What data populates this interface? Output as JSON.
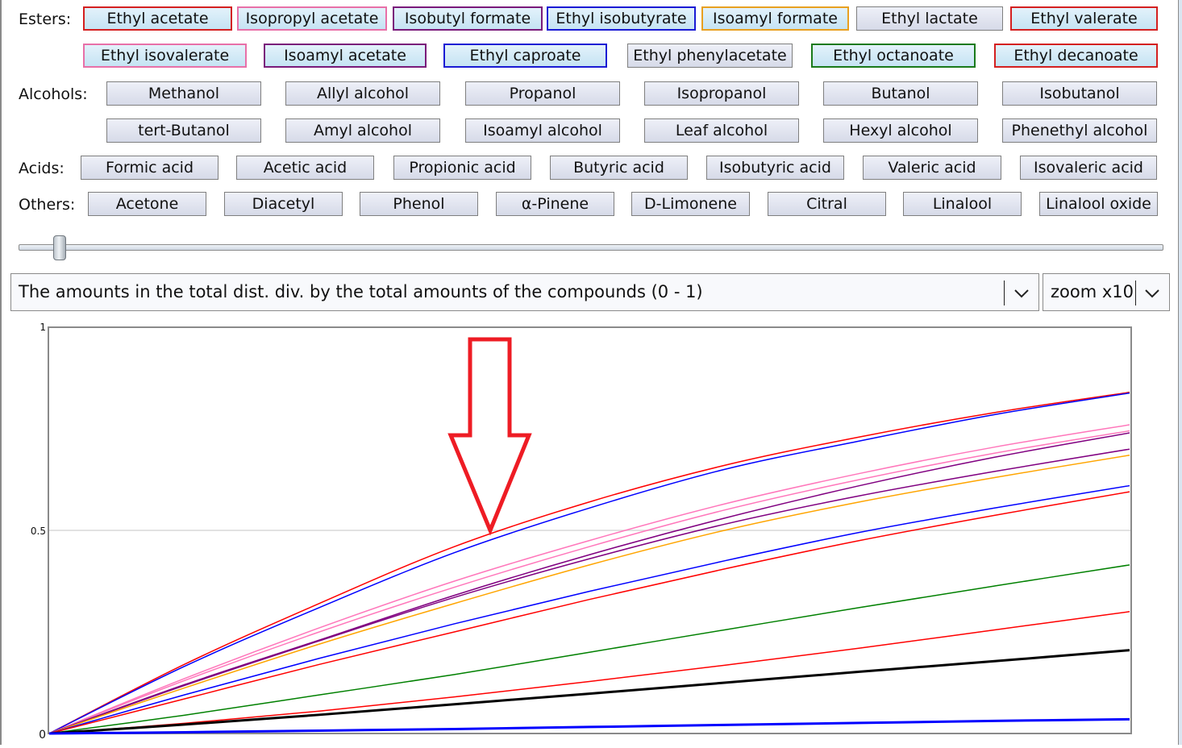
{
  "compound_groups": [
    {
      "label": "Esters:",
      "buttons": [
        {
          "label": "Ethyl acetate",
          "selected": true,
          "color": "#d42020"
        },
        {
          "label": "Isopropyl acetate",
          "selected": true,
          "color": "#e870a8"
        },
        {
          "label": "Isobutyl formate",
          "selected": true,
          "color": "#7a1a7a"
        },
        {
          "label": "Ethyl isobutyrate",
          "selected": true,
          "color": "#1a1ad4"
        },
        {
          "label": "Isoamyl formate",
          "selected": true,
          "color": "#e8a020"
        },
        {
          "label": "Ethyl lactate",
          "selected": false,
          "color": "#7f7f7f"
        },
        {
          "label": "Ethyl valerate",
          "selected": true,
          "color": "#d42020"
        },
        {
          "label": "Ethyl isovalerate",
          "selected": true,
          "color": "#e870a8"
        },
        {
          "label": "Isoamyl acetate",
          "selected": true,
          "color": "#7a1a7a"
        },
        {
          "label": "Ethyl caproate",
          "selected": true,
          "color": "#1a1ad4"
        },
        {
          "label": "Ethyl phenylacetate",
          "selected": false,
          "color": "#7f7f7f"
        },
        {
          "label": "Ethyl octanoate",
          "selected": true,
          "color": "#1a7a1a"
        },
        {
          "label": "Ethyl decanoate",
          "selected": true,
          "color": "#d42020"
        }
      ]
    },
    {
      "label": "Alcohols:",
      "buttons": [
        {
          "label": "Methanol",
          "selected": false
        },
        {
          "label": "Allyl alcohol",
          "selected": false
        },
        {
          "label": "Propanol",
          "selected": false
        },
        {
          "label": "Isopropanol",
          "selected": false
        },
        {
          "label": "Butanol",
          "selected": false
        },
        {
          "label": "Isobutanol",
          "selected": false
        },
        {
          "label": "tert-Butanol",
          "selected": false
        },
        {
          "label": "Amyl alcohol",
          "selected": false
        },
        {
          "label": "Isoamyl alcohol",
          "selected": false
        },
        {
          "label": "Leaf alcohol",
          "selected": false
        },
        {
          "label": "Hexyl alcohol",
          "selected": false
        },
        {
          "label": "Phenethyl alcohol",
          "selected": false
        }
      ]
    },
    {
      "label": "Acids:",
      "buttons": [
        {
          "label": "Formic acid",
          "selected": false
        },
        {
          "label": "Acetic acid",
          "selected": false
        },
        {
          "label": "Propionic acid",
          "selected": false
        },
        {
          "label": "Butyric acid",
          "selected": false
        },
        {
          "label": "Isobutyric acid",
          "selected": false
        },
        {
          "label": "Valeric acid",
          "selected": false
        },
        {
          "label": "Isovaleric acid",
          "selected": false
        }
      ]
    },
    {
      "label": "Others:",
      "buttons": [
        {
          "label": "Acetone",
          "selected": false
        },
        {
          "label": "Diacetyl",
          "selected": false
        },
        {
          "label": "Phenol",
          "selected": false
        },
        {
          "label": "α-Pinene",
          "selected": false
        },
        {
          "label": "D-Limonene",
          "selected": false
        },
        {
          "label": "Citral",
          "selected": false
        },
        {
          "label": "Linalool",
          "selected": false
        },
        {
          "label": "Linalool oxide",
          "selected": false
        }
      ]
    }
  ],
  "slider": {
    "value_fraction": 0.03
  },
  "metric_select": {
    "value": "The amounts in the total dist. div. by the total amounts of the compounds (0 - 1)"
  },
  "zoom_select": {
    "value": "zoom x10"
  },
  "annotation": {
    "type": "arrow-down",
    "color": "#ee1c24"
  },
  "chart_data": {
    "type": "line",
    "title": "",
    "xlabel": "",
    "ylabel": "",
    "ylim": [
      0,
      1
    ],
    "yticks": [
      "0",
      "0.5",
      "1"
    ],
    "ytick_values": [
      0,
      0.5,
      1
    ],
    "grid": "horizontal at 0.5",
    "x": [
      0,
      0.125,
      0.25,
      0.375,
      0.5,
      0.625,
      0.75,
      0.875,
      1
    ],
    "series": [
      {
        "name": "Ethyl acetate",
        "color": "#ff0000",
        "width": 1.5,
        "values": [
          0,
          0.17,
          0.32,
          0.46,
          0.57,
          0.66,
          0.73,
          0.79,
          0.84
        ]
      },
      {
        "name": "Ethyl isobutyrate",
        "color": "#0000ff",
        "width": 1.5,
        "values": [
          0,
          0.165,
          0.31,
          0.445,
          0.555,
          0.65,
          0.72,
          0.785,
          0.838
        ]
      },
      {
        "name": "Isopropyl acetate",
        "color": "#ff77bb",
        "width": 1.5,
        "values": [
          0,
          0.135,
          0.26,
          0.375,
          0.475,
          0.565,
          0.64,
          0.705,
          0.76
        ]
      },
      {
        "name": "Ethyl isovalerate",
        "color": "#ff77bb",
        "width": 1.5,
        "values": [
          0,
          0.13,
          0.25,
          0.36,
          0.46,
          0.55,
          0.625,
          0.69,
          0.745
        ]
      },
      {
        "name": "Isobutyl formate",
        "color": "#800080",
        "width": 1.5,
        "values": [
          0,
          0.12,
          0.23,
          0.34,
          0.44,
          0.53,
          0.61,
          0.68,
          0.74
        ]
      },
      {
        "name": "Isoamyl acetate",
        "color": "#800080",
        "width": 1.5,
        "values": [
          0,
          0.118,
          0.228,
          0.335,
          0.43,
          0.515,
          0.585,
          0.645,
          0.7
        ]
      },
      {
        "name": "Isoamyl formate",
        "color": "#ffa500",
        "width": 1.5,
        "values": [
          0,
          0.112,
          0.22,
          0.32,
          0.415,
          0.5,
          0.57,
          0.63,
          0.685
        ]
      },
      {
        "name": "Ethyl caproate",
        "color": "#0000ff",
        "width": 1.5,
        "values": [
          0,
          0.095,
          0.185,
          0.27,
          0.35,
          0.425,
          0.495,
          0.555,
          0.61
        ]
      },
      {
        "name": "Ethyl valerate",
        "color": "#ff0000",
        "width": 1.5,
        "values": [
          0,
          0.085,
          0.17,
          0.25,
          0.33,
          0.405,
          0.475,
          0.537,
          0.595
        ]
      },
      {
        "name": "Ethyl octanoate",
        "color": "#008000",
        "width": 1.5,
        "values": [
          0,
          0.045,
          0.095,
          0.145,
          0.2,
          0.255,
          0.31,
          0.363,
          0.415
        ]
      },
      {
        "name": "Ethyl decanoate",
        "color": "#ff0000",
        "width": 1.5,
        "values": [
          0,
          0.025,
          0.055,
          0.09,
          0.128,
          0.168,
          0.21,
          0.255,
          0.3
        ]
      },
      {
        "name": "Total (black)",
        "color": "#000000",
        "width": 3,
        "values": [
          0,
          0.022,
          0.046,
          0.072,
          0.098,
          0.125,
          0.152,
          0.178,
          0.205
        ]
      },
      {
        "name": "Baseline (blue)",
        "color": "#0000ff",
        "width": 3,
        "values": [
          0,
          0.003,
          0.007,
          0.011,
          0.016,
          0.021,
          0.026,
          0.031,
          0.035
        ]
      }
    ]
  }
}
